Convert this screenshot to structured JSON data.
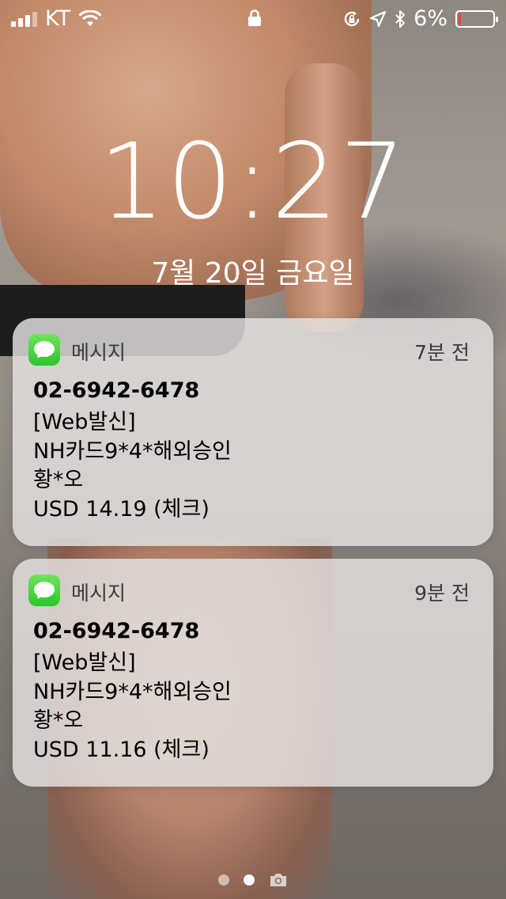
{
  "status_bar": {
    "carrier": "KT",
    "battery_percent_label": "6%",
    "battery_level": 0.06,
    "icons": [
      "signal-icon",
      "wifi-icon",
      "lock-icon",
      "orientation-lock-icon",
      "location-icon",
      "bluetooth-icon",
      "battery-icon"
    ]
  },
  "lock_screen": {
    "time": "10:27",
    "date": "7월 20일 금요일"
  },
  "notifications": [
    {
      "app": "메시지",
      "time": "7분 전",
      "title": "02-6942-6478",
      "lines": [
        "[Web발신]",
        "NH카드9*4*해외승인",
        "황*오",
        "USD 14.19 (체크)"
      ]
    },
    {
      "app": "메시지",
      "time": "9분 전",
      "title": "02-6942-6478",
      "lines": [
        "[Web발신]",
        "NH카드9*4*해외승인",
        "황*오",
        "USD 11.16 (체크)"
      ]
    }
  ],
  "page_indicator": {
    "pages": 2,
    "active": 2,
    "camera_icon": "camera-icon"
  },
  "colors": {
    "battery_low": "#ff3b30",
    "messages_green": "#2cc52c"
  }
}
